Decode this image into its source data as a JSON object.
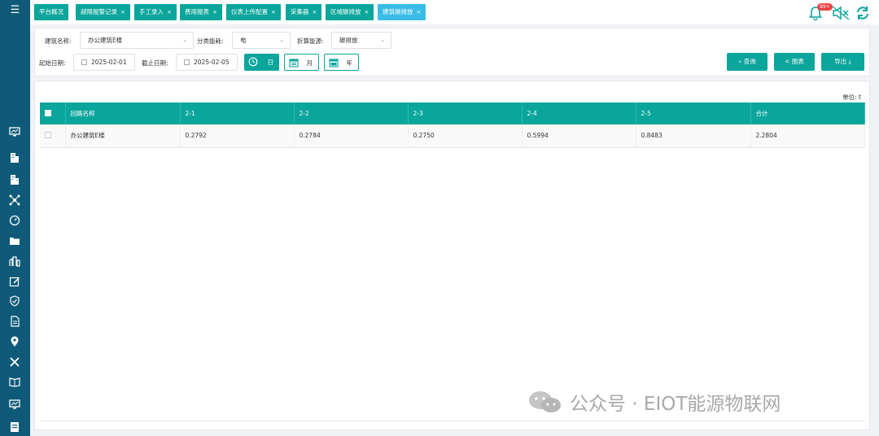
{
  "sidebar": {
    "menu_icon": "hamburger-icon",
    "items": [
      {
        "icon": "monitor-icon"
      },
      {
        "icon": "building-icon"
      },
      {
        "icon": "building-alt-icon"
      },
      {
        "icon": "network-icon"
      },
      {
        "icon": "gauge-icon"
      },
      {
        "icon": "folder-icon"
      },
      {
        "icon": "city-icon"
      },
      {
        "icon": "edit-icon"
      },
      {
        "icon": "shield-icon"
      },
      {
        "icon": "document-icon"
      },
      {
        "icon": "location-icon"
      },
      {
        "icon": "tools-icon"
      },
      {
        "icon": "book-icon"
      },
      {
        "icon": "screen-icon"
      },
      {
        "icon": "report-icon"
      }
    ]
  },
  "tabs": [
    {
      "label": "平台概况",
      "closable": false
    },
    {
      "label": "越限报警记录",
      "closable": true
    },
    {
      "label": "手工录入",
      "closable": true
    },
    {
      "label": "费用报表",
      "closable": true
    },
    {
      "label": "仪表上传配置",
      "closable": true
    },
    {
      "label": "采集器",
      "closable": true
    },
    {
      "label": "区域碳排放",
      "closable": true
    },
    {
      "label": "建筑碳排放",
      "closable": true,
      "active": true
    }
  ],
  "header": {
    "notification_count": "99+"
  },
  "filters": {
    "building_label": "建筑名称:",
    "building_value": "办公建筑E楼",
    "category_label": "分类能耗:",
    "category_value": "电",
    "conversion_label": "折算能源:",
    "conversion_value": "碳排放",
    "start_label": "起始日期:",
    "start_value": "2025-02-01",
    "end_label": "截止日期:",
    "end_value": "2025-02-05",
    "period_day": "日",
    "period_month": "月",
    "period_year": "年"
  },
  "actions": {
    "query": "查询",
    "chart": "图表",
    "export": "导出"
  },
  "table": {
    "unit_label": "单位:  t",
    "columns": [
      "回路名称",
      "2-1",
      "2-2",
      "2-3",
      "2-4",
      "2-5",
      "合计"
    ],
    "rows": [
      [
        "办公建筑E楼",
        "0.2792",
        "0.2784",
        "0.2750",
        "0.5994",
        "0.8483",
        "2.2804"
      ]
    ]
  },
  "watermark": {
    "text": "公众号 · EIOT能源物联网"
  },
  "colors": {
    "primary": "#0aa59b",
    "sidebar": "#0e5a78",
    "active_tab": "#39bde8",
    "badge": "#ef4444"
  }
}
